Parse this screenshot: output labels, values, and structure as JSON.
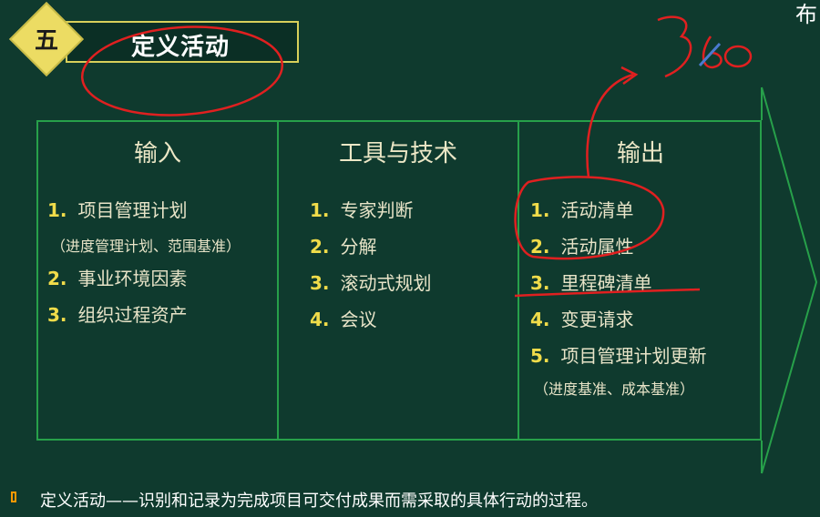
{
  "header": {
    "badge_number": "五",
    "title": "定义活动"
  },
  "columns": [
    {
      "heading": "输入",
      "items": [
        {
          "num": "1.",
          "text": "项目管理计划"
        },
        {
          "num": "2.",
          "text": "事业环境因素"
        },
        {
          "num": "3.",
          "text": "组织过程资产"
        }
      ],
      "note": "（进度管理计划、范围基准）"
    },
    {
      "heading": "工具与技术",
      "items": [
        {
          "num": "1.",
          "text": "专家判断"
        },
        {
          "num": "2.",
          "text": "分解"
        },
        {
          "num": "3.",
          "text": "滚动式规划"
        },
        {
          "num": "4.",
          "text": "会议"
        }
      ]
    },
    {
      "heading": "输出",
      "items": [
        {
          "num": "1.",
          "text": "活动清单"
        },
        {
          "num": "2.",
          "text": "活动属性"
        },
        {
          "num": "3.",
          "text": "里程碑清单"
        },
        {
          "num": "4.",
          "text": "变更请求"
        },
        {
          "num": "5.",
          "text": "项目管理计划更新"
        }
      ],
      "note": "（进度基准、成本基准）"
    }
  ],
  "footer": {
    "text": "定义活动——识别和记录为完成项目可交付成果而需采取的具体行动的过程。"
  },
  "logo": {
    "text": "布"
  },
  "annotation": {
    "handwritten": "360"
  },
  "colors": {
    "background": "#0f3a2e",
    "frame_green": "#27a04a",
    "accent_yellow": "#f0dc4a",
    "annotation_red": "#e02020"
  }
}
